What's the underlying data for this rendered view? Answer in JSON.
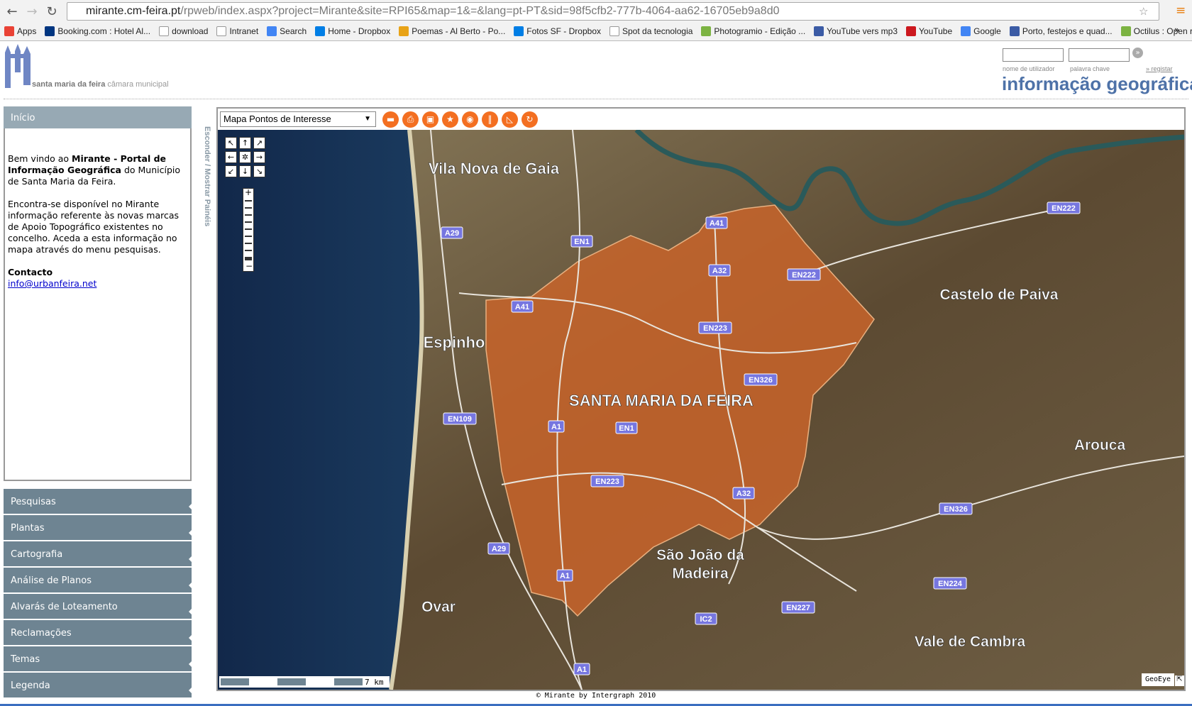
{
  "browser": {
    "url_host": "mirante.cm-feira.pt",
    "url_path": "/rpweb/index.aspx?project=Mirante&site=RPI65&map=1&=&lang=pt-PT&sid=98f5cfb2-777b-4064-aa62-16705eb9a8d0",
    "bookmarks": [
      {
        "label": "Apps",
        "color": "#e94235"
      },
      {
        "label": "Booking.com : Hotel Al...",
        "color": "#003580"
      },
      {
        "label": "download",
        "color": "#ffffff"
      },
      {
        "label": "Intranet",
        "color": "#ffffff"
      },
      {
        "label": "Search",
        "color": "#4285f4"
      },
      {
        "label": "Home - Dropbox",
        "color": "#007ee5"
      },
      {
        "label": "Poemas - Al Berto - Po...",
        "color": "#e8a317"
      },
      {
        "label": "Fotos SF - Dropbox",
        "color": "#007ee5"
      },
      {
        "label": "Spot da tecnologia",
        "color": "#ffffff"
      },
      {
        "label": "Photogramio - Edição ...",
        "color": "#7cb342"
      },
      {
        "label": "YouTube vers mp3",
        "color": "#3b5ba5"
      },
      {
        "label": "YouTube",
        "color": "#cc181e"
      },
      {
        "label": "Google",
        "color": "#4285f4"
      },
      {
        "label": "Porto, festejos e quad...",
        "color": "#3b5ba5"
      },
      {
        "label": "Octilus : Open requests",
        "color": "#7cb342"
      }
    ],
    "more": "»"
  },
  "header": {
    "logo_name": "santa maria da feira",
    "logo_sub": "câmara municipal",
    "username_label": "nome de utilizador",
    "password_label": "palavra chave",
    "register_link": "» registar",
    "title": "informação geográfica"
  },
  "sidebar": {
    "home_title": "Início",
    "welcome_pre": "Bem vindo ao ",
    "welcome_bold": "Mirante - Portal de Informação Geográfica",
    "welcome_post": " do Município de Santa Maria da Feira.",
    "info": "Encontra-se disponível no Mirante informação referente às novas marcas de Apoio Topográfico existentes no concelho. Aceda a esta informação no mapa através do menu pesquisas.",
    "contact_title": "Contacto",
    "contact_email": "info@urbanfeira.net",
    "menu": [
      "Pesquisas",
      "Plantas",
      "Cartografia",
      "Análise de Planos",
      "Alvarás de Loteamento",
      "Reclamações",
      "Temas",
      "Legenda"
    ],
    "toggle": "Esconder / Mostrar Painéis"
  },
  "map": {
    "layer": "Mapa Pontos de Interesse",
    "tools": [
      "ruler-icon",
      "print-icon",
      "save-icon",
      "star-icon",
      "target-icon",
      "measure-icon",
      "area-icon",
      "refresh-icon"
    ],
    "tool_color": "#f36f21",
    "place_labels": [
      "Vila Nova de Gaia",
      "Espinho",
      "SANTA MARIA DA FEIRA",
      "Castelo de Paiva",
      "Arouca",
      "São João da",
      "Madeira",
      "Ovar",
      "Vale de Cambra"
    ],
    "road_labels": [
      "A29",
      "EN1",
      "A41",
      "A32",
      "EN222",
      "A41",
      "EN223",
      "EN326",
      "EN109",
      "A1",
      "EN1",
      "EN223",
      "A32",
      "A29",
      "A1",
      "EN227",
      "IC2",
      "A1",
      "EN222",
      "EN326",
      "EN224"
    ],
    "scale": "7 km",
    "attribution": "GeoEye",
    "municipality_color": "#c8642a"
  },
  "footer": "© Mirante by Intergraph 2010"
}
